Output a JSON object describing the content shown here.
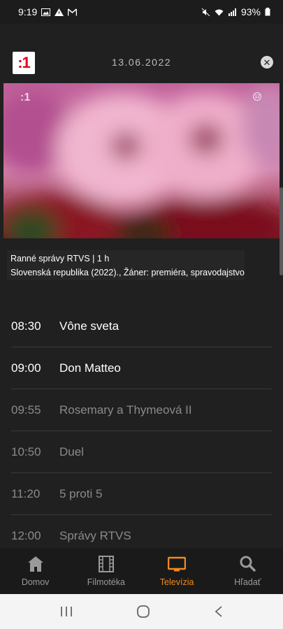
{
  "status": {
    "time": "9:19",
    "battery": "93%"
  },
  "header": {
    "channel_logo": ":1",
    "date": "13.06.2022",
    "close_symbol": "✕"
  },
  "player": {
    "watermark": ":1",
    "age_rating": "12"
  },
  "program_info": {
    "title_line": "Ranné správy RTVS | 1 h",
    "details_line": "Slovenská republika (2022)., Žáner: premiéra, spravodajstvo"
  },
  "schedule": [
    {
      "time": "08:30",
      "title": "Vône sveta",
      "state": "now"
    },
    {
      "time": "09:00",
      "title": "Don Matteo",
      "state": "now"
    },
    {
      "time": "09:55",
      "title": "Rosemary a Thymeová II",
      "state": "future"
    },
    {
      "time": "10:50",
      "title": "Duel",
      "state": "future"
    },
    {
      "time": "11:20",
      "title": "5 proti 5",
      "state": "future"
    },
    {
      "time": "12:00",
      "title": "Správy RTVS",
      "state": "future"
    }
  ],
  "bottom_nav": {
    "items": [
      {
        "label": "Domov",
        "icon": "home-icon"
      },
      {
        "label": "Filmotéka",
        "icon": "film-icon"
      },
      {
        "label": "Televízia",
        "icon": "tv-icon"
      },
      {
        "label": "Hľadať",
        "icon": "search-icon"
      }
    ],
    "active": "Televízia",
    "active_color": "#f08a1d"
  }
}
